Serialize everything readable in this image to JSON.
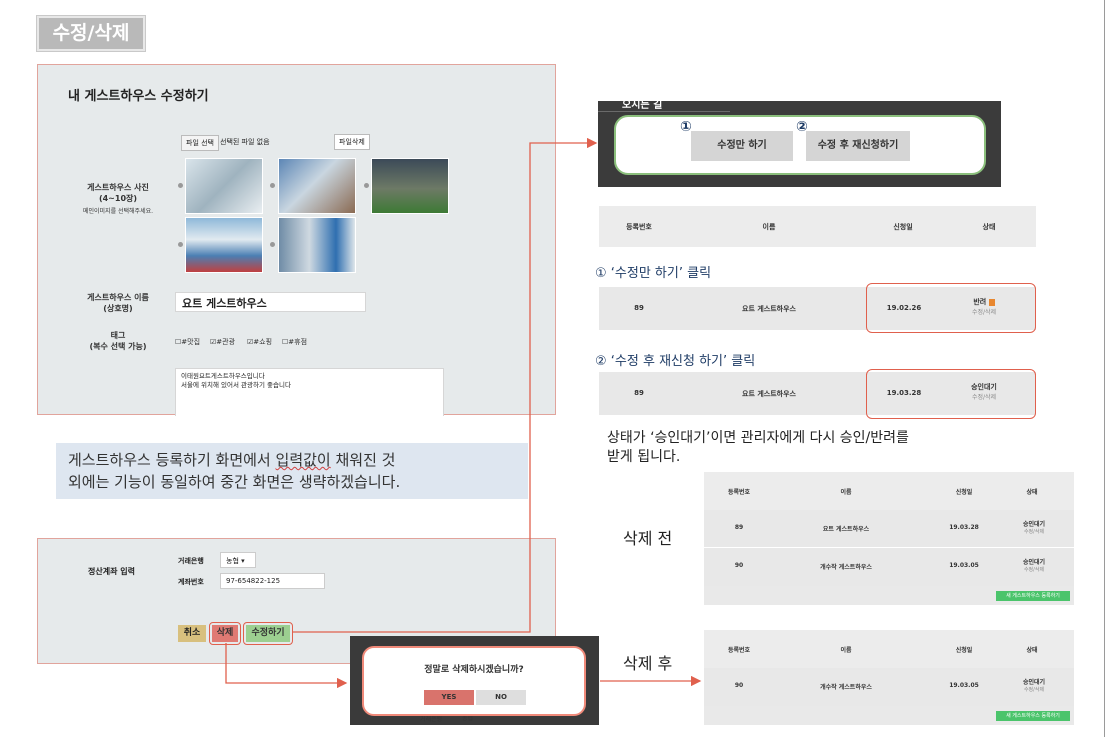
{
  "header": {
    "section_title": "수정/삭제"
  },
  "edit_form": {
    "title": "내 게스트하우스 수정하기",
    "file_choose": "파일 선택",
    "file_none": "선택된 파일 없음",
    "file_delete": "파일삭제",
    "photo_label": "게스트하우스 사진",
    "photo_count": "(4~10장)",
    "photo_hint": "메인이미지를 선택해주세요.",
    "name_label": "게스트하우스 이름",
    "name_sub": "(상호명)",
    "name_value": "요트 게스트하우스",
    "tag_label": "태그",
    "tag_sub": "(복수 선택 가능)",
    "tags": [
      "#맛집",
      "#관광",
      "#쇼핑",
      "#휴점"
    ],
    "desc_line1": "이태원요트게스트하우스입니다",
    "desc_line2": "서울에 위치해 있어서 관광하기 좋습니다"
  },
  "note": {
    "part1": "게스트하우스 등록하기 화면에서 ",
    "wavy": "입력값이",
    "part2": " 채워진 것",
    "line2": "외에는 기능이 동일하여 중간 화면은 생략하겠습니다."
  },
  "settlement": {
    "label": "정산계좌 입력",
    "bank_label": "거래은행",
    "bank_value": "농협",
    "account_label": "계좌번호",
    "account_value": "97-654822-125",
    "cancel": "취소",
    "delete": "삭제",
    "edit": "수정하기"
  },
  "dialog": {
    "question": "정말로 삭제하시겠습니까?",
    "yes": "YES",
    "no": "NO",
    "behind_bank": "거래은행",
    "behind_bank_value": "농협"
  },
  "edit_buttons": {
    "partial_top": "오시는 길",
    "num1": "①",
    "num2": "②",
    "edit_only": "수정만 하기",
    "edit_resubmit": "수정 후 재신청하기"
  },
  "table": {
    "headers": [
      "등록번호",
      "이름",
      "신청일",
      "상태"
    ]
  },
  "step1": {
    "label": "① ‘수정만 하기’ 클릭",
    "row": {
      "id": "89",
      "name": "요트 게스트하우스",
      "date": "19.02.26",
      "status": "반려",
      "action": "수정/삭제"
    }
  },
  "step2": {
    "label": "② ‘수정 후 재신청 하기’ 클릭",
    "row": {
      "id": "89",
      "name": "요트 게스트하우스",
      "date": "19.03.28",
      "status": "승인대기",
      "action": "수정/삭제"
    }
  },
  "explain": {
    "line1": "상태가 ‘승인대기’이면 관리자에게 다시 승인/반려를",
    "line2": "받게 됩니다."
  },
  "before_delete": {
    "label": "삭제 전",
    "rows": [
      {
        "id": "89",
        "name": "요트 게스트하우스",
        "date": "19.03.28",
        "status": "승인대기",
        "action": "수정/삭제"
      },
      {
        "id": "90",
        "name": "개수작 게스트하우스",
        "date": "19.03.05",
        "status": "승인대기",
        "action": "수정/삭제"
      }
    ],
    "new_button": "새 게스트하우스 등록하기"
  },
  "after_delete": {
    "label": "삭제 후",
    "rows": [
      {
        "id": "90",
        "name": "개수작 게스트하우스",
        "date": "19.03.05",
        "status": "승인대기",
        "action": "수정/삭제"
      }
    ],
    "new_button": "새 게스트하우스 등록하기"
  },
  "colors": {
    "accent_red": "#e0604d",
    "panel_bg": "#e6eaeb",
    "green": "#4bc46b",
    "navy": "#1f3c66"
  }
}
